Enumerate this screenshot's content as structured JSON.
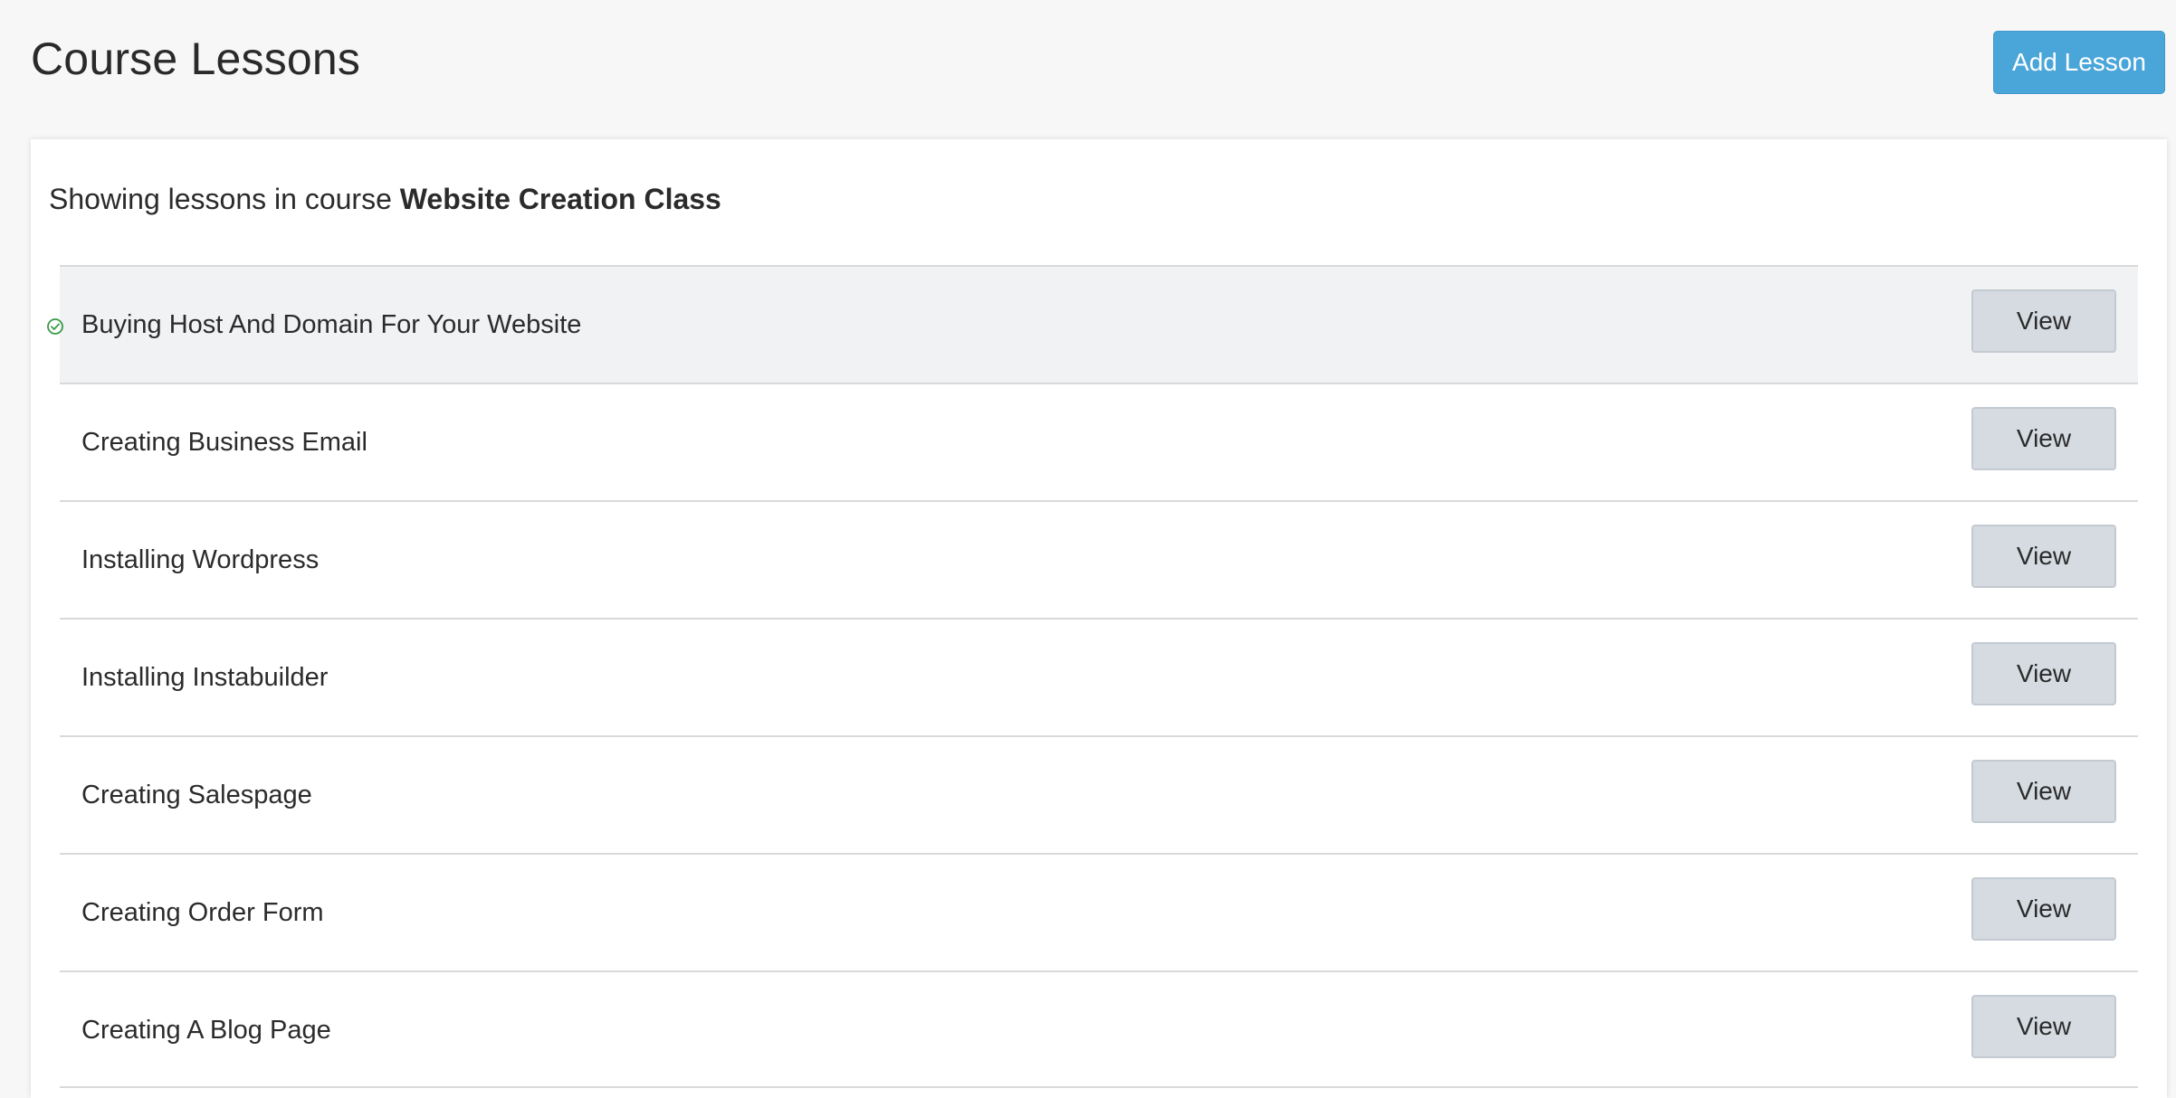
{
  "header": {
    "title": "Course Lessons",
    "add_button_label": "Add Lesson"
  },
  "subtitle": {
    "prefix": "Showing lessons in course ",
    "course_name": "Website Creation Class"
  },
  "lessons": [
    {
      "title": "Buying Host And Domain For Your Website",
      "completed": true,
      "action_label": "View"
    },
    {
      "title": "Creating Business Email",
      "completed": false,
      "action_label": "View"
    },
    {
      "title": "Installing Wordpress",
      "completed": false,
      "action_label": "View"
    },
    {
      "title": "Installing Instabuilder",
      "completed": false,
      "action_label": "View"
    },
    {
      "title": "Creating Salespage",
      "completed": false,
      "action_label": "View"
    },
    {
      "title": "Creating Order Form",
      "completed": false,
      "action_label": "View"
    },
    {
      "title": "Creating A Blog Page",
      "completed": false,
      "action_label": "View"
    }
  ],
  "icons": {
    "completed": "check-circle-icon"
  },
  "colors": {
    "accent": "#4aa6d9",
    "completed_check": "#3a9a4a",
    "active_row_bg": "#f1f2f4",
    "view_button_bg": "#d5dbe1"
  }
}
